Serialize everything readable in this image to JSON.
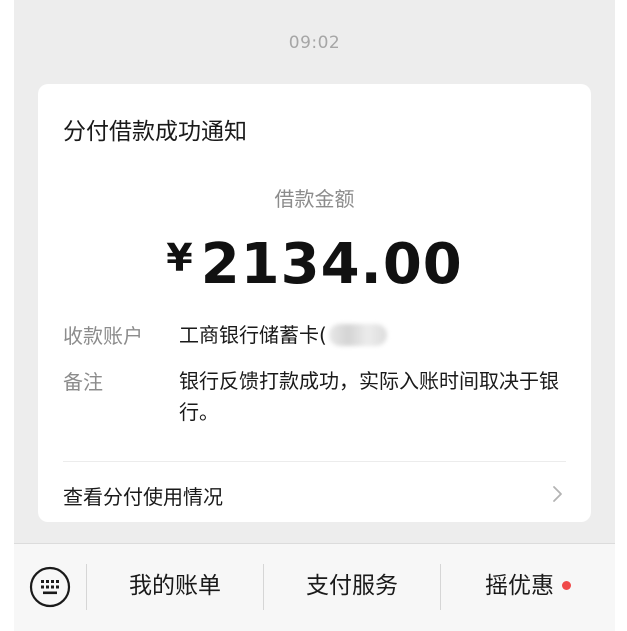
{
  "timestamp": "09:02",
  "card": {
    "title": "分付借款成功通知",
    "amount_label": "借款金额",
    "currency": "¥",
    "amount": "2134.00",
    "account_label": "收款账户",
    "account_value": "工商银行储蓄卡(",
    "note_label": "备注",
    "note_value": "银行反馈打款成功，实际入账时间取决于银行。",
    "usage_link": "查看分付使用情况"
  },
  "bottom_menu": {
    "items": [
      "我的账单",
      "支付服务",
      "摇优惠"
    ],
    "badge_color": "#f04a4a"
  },
  "icons": {
    "keyboard": "keyboard-icon",
    "chevron": "chevron-right-icon"
  }
}
